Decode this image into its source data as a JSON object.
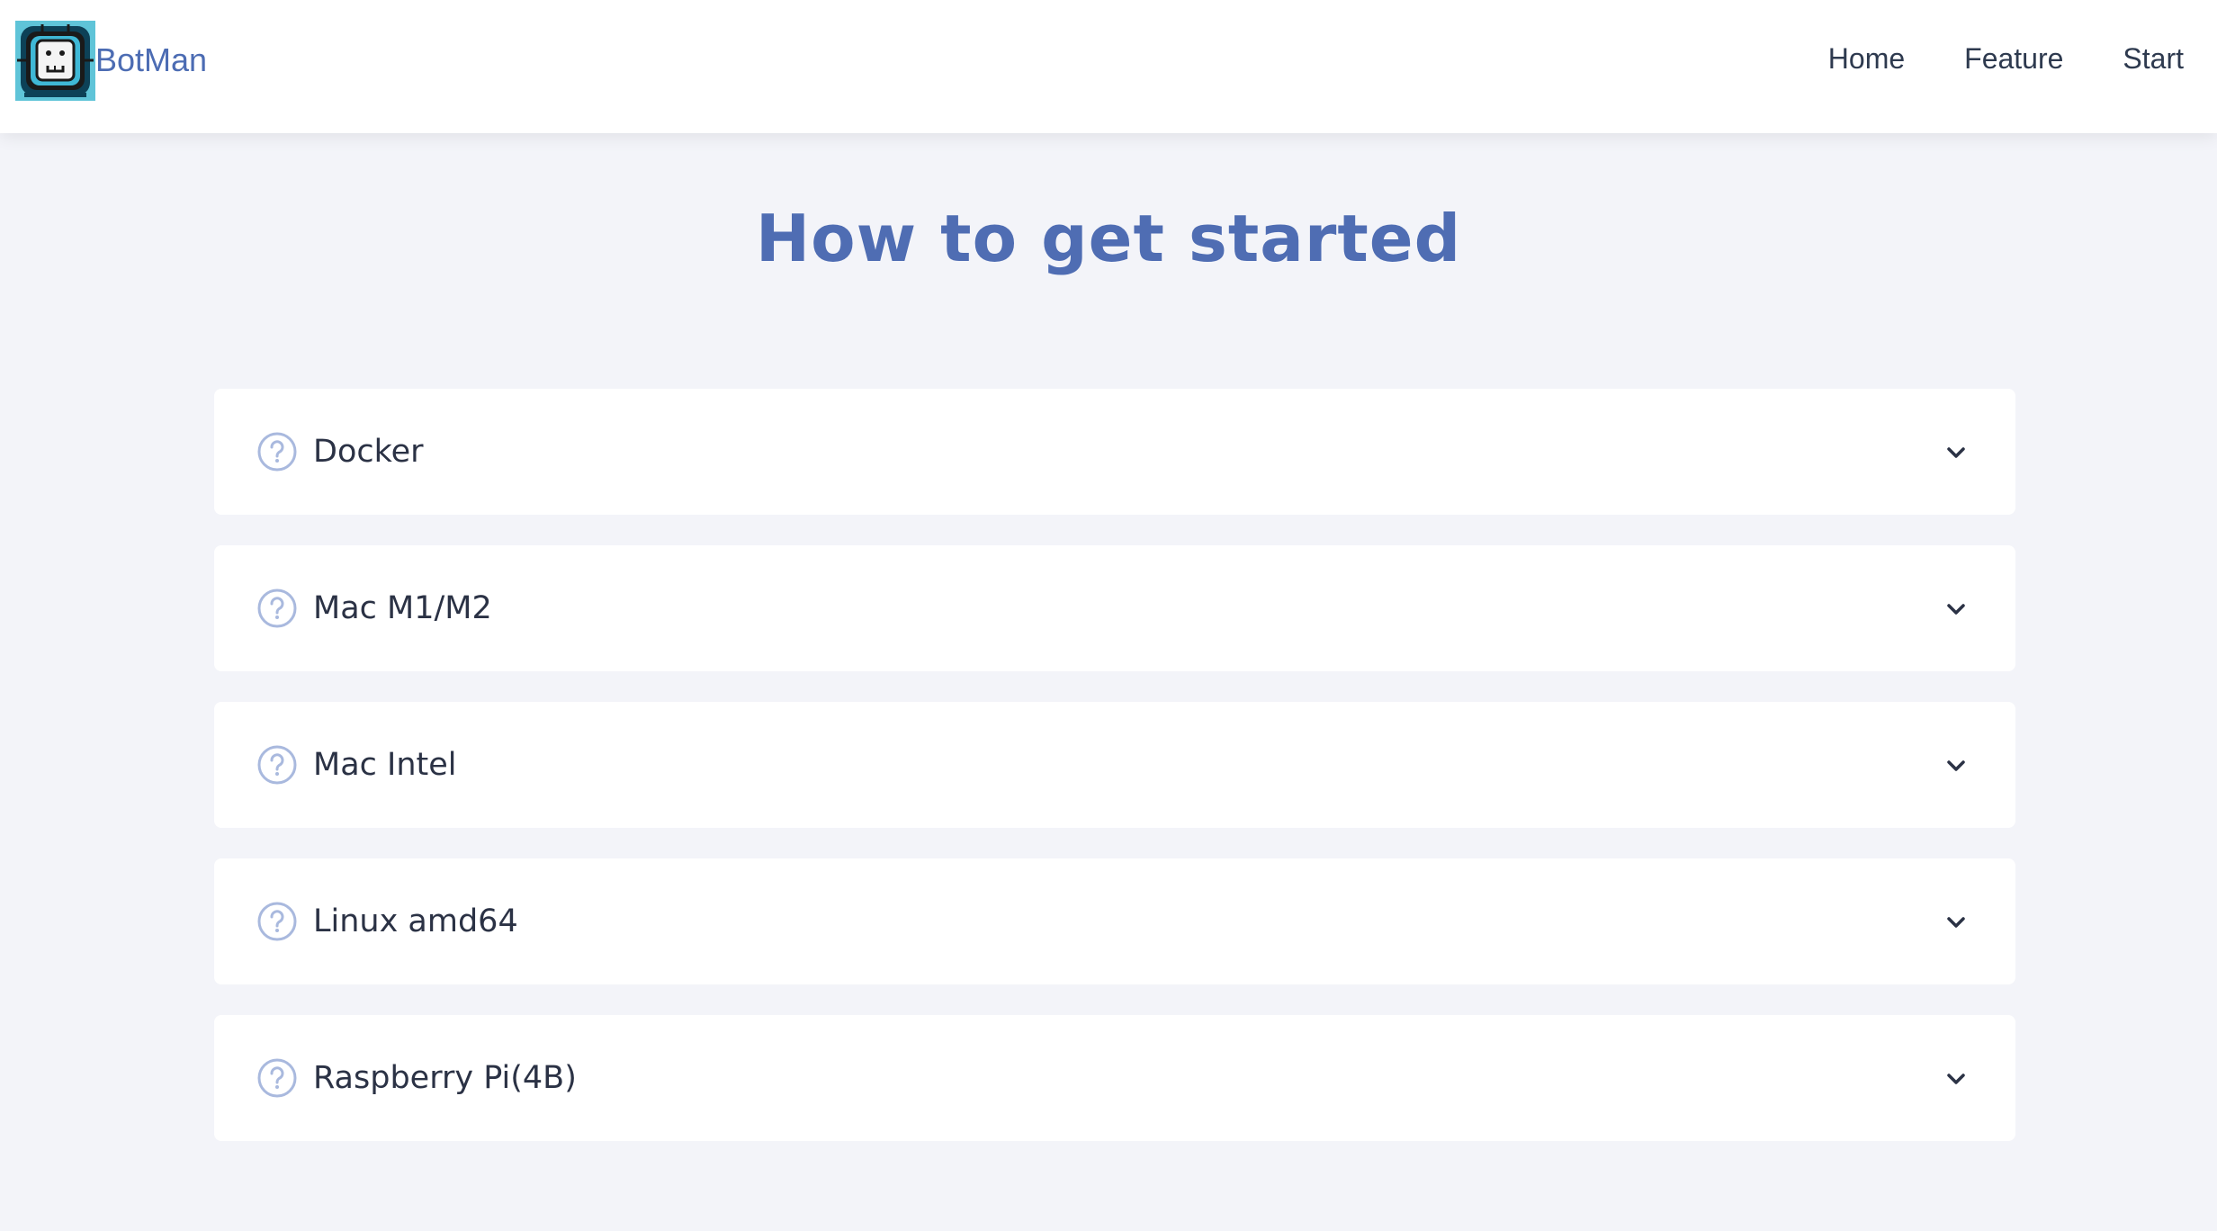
{
  "header": {
    "brand": "BotMan",
    "logo_icon": "robot-logo-icon",
    "nav": [
      {
        "label": "Home"
      },
      {
        "label": "Feature"
      },
      {
        "label": "Start"
      }
    ]
  },
  "main": {
    "title": "How to get started",
    "faq_items": [
      {
        "label": "Docker",
        "icon": "question-circle-icon",
        "expand_icon": "chevron-down-icon"
      },
      {
        "label": "Mac M1/M2",
        "icon": "question-circle-icon",
        "expand_icon": "chevron-down-icon"
      },
      {
        "label": "Mac Intel",
        "icon": "question-circle-icon",
        "expand_icon": "chevron-down-icon"
      },
      {
        "label": "Linux amd64",
        "icon": "question-circle-icon",
        "expand_icon": "chevron-down-icon"
      },
      {
        "label": "Raspberry Pi(4B)",
        "icon": "question-circle-icon",
        "expand_icon": "chevron-down-icon"
      }
    ]
  },
  "colors": {
    "accent": "#4f6db3",
    "background": "#f3f4f9",
    "card": "#ffffff",
    "text": "#2b3245",
    "icon": "#a9b9de"
  }
}
